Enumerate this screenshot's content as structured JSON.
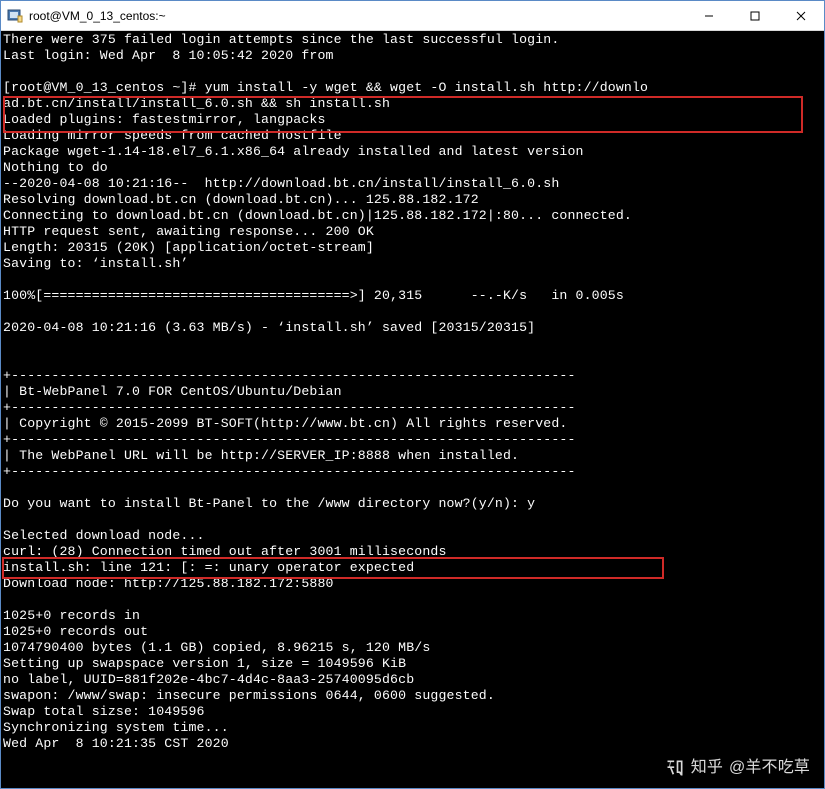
{
  "window": {
    "title": "root@VM_0_13_centos:~"
  },
  "watermark": {
    "brand": "知乎",
    "user": "@羊不吃草"
  },
  "terminal": {
    "lines": [
      "There were 375 failed login attempts since the last successful login.",
      "Last login: Wed Apr  8 10:05:42 2020 from",
      "",
      "[root@VM_0_13_centos ~]# yum install -y wget && wget -O install.sh http://downlo",
      "ad.bt.cn/install/install_6.0.sh && sh install.sh",
      "Loaded plugins: fastestmirror, langpacks",
      "Loading mirror speeds from cached hostfile",
      "Package wget-1.14-18.el7_6.1.x86_64 already installed and latest version",
      "Nothing to do",
      "--2020-04-08 10:21:16--  http://download.bt.cn/install/install_6.0.sh",
      "Resolving download.bt.cn (download.bt.cn)... 125.88.182.172",
      "Connecting to download.bt.cn (download.bt.cn)|125.88.182.172|:80... connected.",
      "HTTP request sent, awaiting response... 200 OK",
      "Length: 20315 (20K) [application/octet-stream]",
      "Saving to: ‘install.sh’",
      "",
      "100%[======================================>] 20,315      --.-K/s   in 0.005s",
      "",
      "2020-04-08 10:21:16 (3.63 MB/s) - ‘install.sh’ saved [20315/20315]",
      "",
      "",
      "+----------------------------------------------------------------------",
      "| Bt-WebPanel 7.0 FOR CentOS/Ubuntu/Debian",
      "+----------------------------------------------------------------------",
      "| Copyright © 2015-2099 BT-SOFT(http://www.bt.cn) All rights reserved.",
      "+----------------------------------------------------------------------",
      "| The WebPanel URL will be http://SERVER_IP:8888 when installed.",
      "+----------------------------------------------------------------------",
      "",
      "Do you want to install Bt-Panel to the /www directory now?(y/n): y",
      "",
      "Selected download node...",
      "curl: (28) Connection timed out after 3001 milliseconds",
      "install.sh: line 121: [: =: unary operator expected",
      "Download node: http://125.88.182.172:5880",
      "",
      "1025+0 records in",
      "1025+0 records out",
      "1074790400 bytes (1.1 GB) copied, 8.96215 s, 120 MB/s",
      "Setting up swapspace version 1, size = 1049596 KiB",
      "no label, UUID=881f202e-4bc7-4d4c-8aa3-25740095d6cb",
      "swapon: /www/swap: insecure permissions 0644, 0600 suggested.",
      "Swap total sizse: 1049596",
      "Synchronizing system time...",
      "Wed Apr  8 10:21:35 CST 2020"
    ]
  }
}
